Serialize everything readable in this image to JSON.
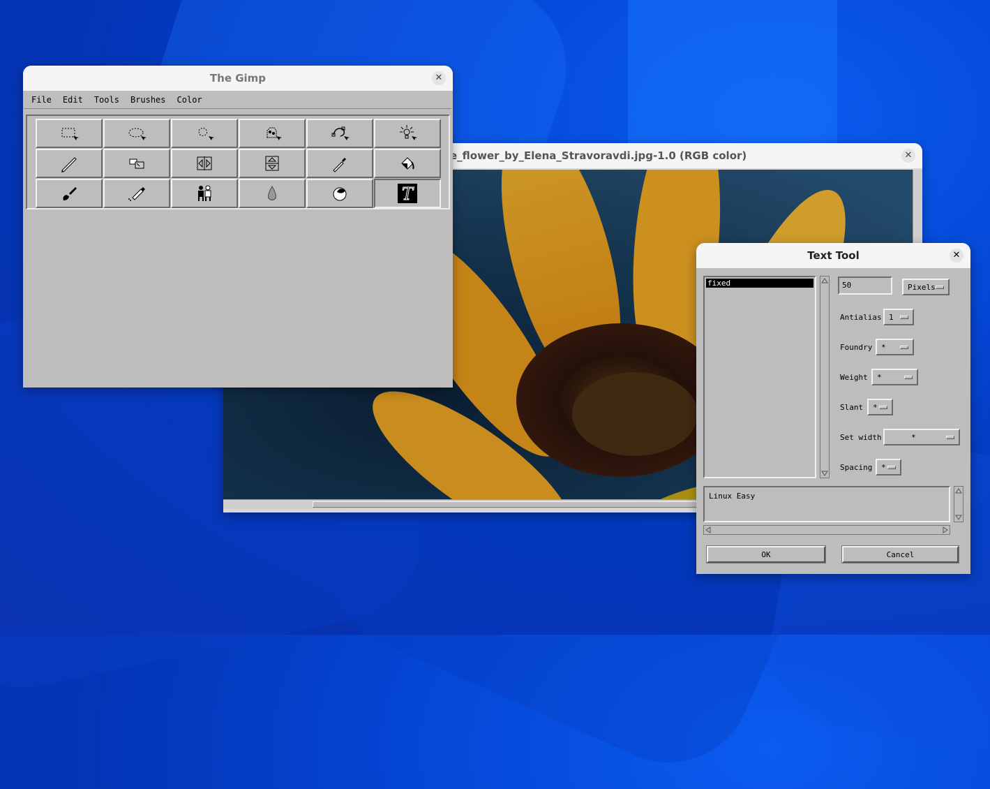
{
  "gimp": {
    "title": "The Gimp",
    "menu": [
      "File",
      "Edit",
      "Tools",
      "Brushes",
      "Color"
    ],
    "tools": [
      "rect-select-icon",
      "ellipse-select-icon",
      "free-select-icon",
      "fuzzy-select-icon",
      "bezier-select-icon",
      "intelligent-scissors-icon",
      "move-crop-icon",
      "transform-icon",
      "flip-horizontal-icon",
      "flip-vertical-icon",
      "color-picker-icon",
      "bucket-fill-icon",
      "paintbrush-icon",
      "airbrush-icon",
      "clone-icon",
      "blur-icon",
      "ink-icon",
      "text-tool-icon"
    ]
  },
  "image_window": {
    "title": "e_flower_by_Elena_Stravoravdi.jpg-1.0 (RGB color)"
  },
  "text_tool": {
    "title": "Text Tool",
    "font_list": [
      "fixed"
    ],
    "size_value": "50",
    "unit": "Pixels",
    "antialias_label": "Antialias",
    "antialias_value": "1",
    "foundry_label": "Foundry",
    "foundry_value": "*",
    "weight_label": "Weight",
    "weight_value": "*",
    "slant_label": "Slant",
    "slant_value": "*",
    "setwidth_label": "Set width",
    "setwidth_value": "*",
    "spacing_label": "Spacing",
    "spacing_value": "*",
    "preview_text": "Linux Easy",
    "ok_label": "OK",
    "cancel_label": "Cancel"
  }
}
